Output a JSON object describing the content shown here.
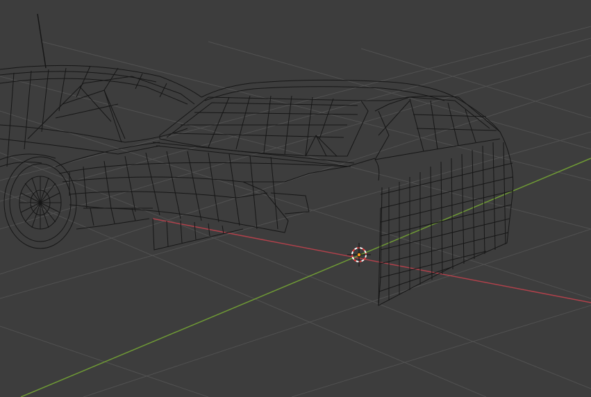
{
  "viewport": {
    "background": "#3d3d3d",
    "grid_color": "#515151",
    "x_axis_color": "#b0414b",
    "y_axis_color": "#6f9a35",
    "wire_color": "#111111",
    "cursor_colors": {
      "ring_red": "#e23b3b",
      "ring_white": "#ffffff",
      "origin": "#ff9a1c"
    }
  }
}
